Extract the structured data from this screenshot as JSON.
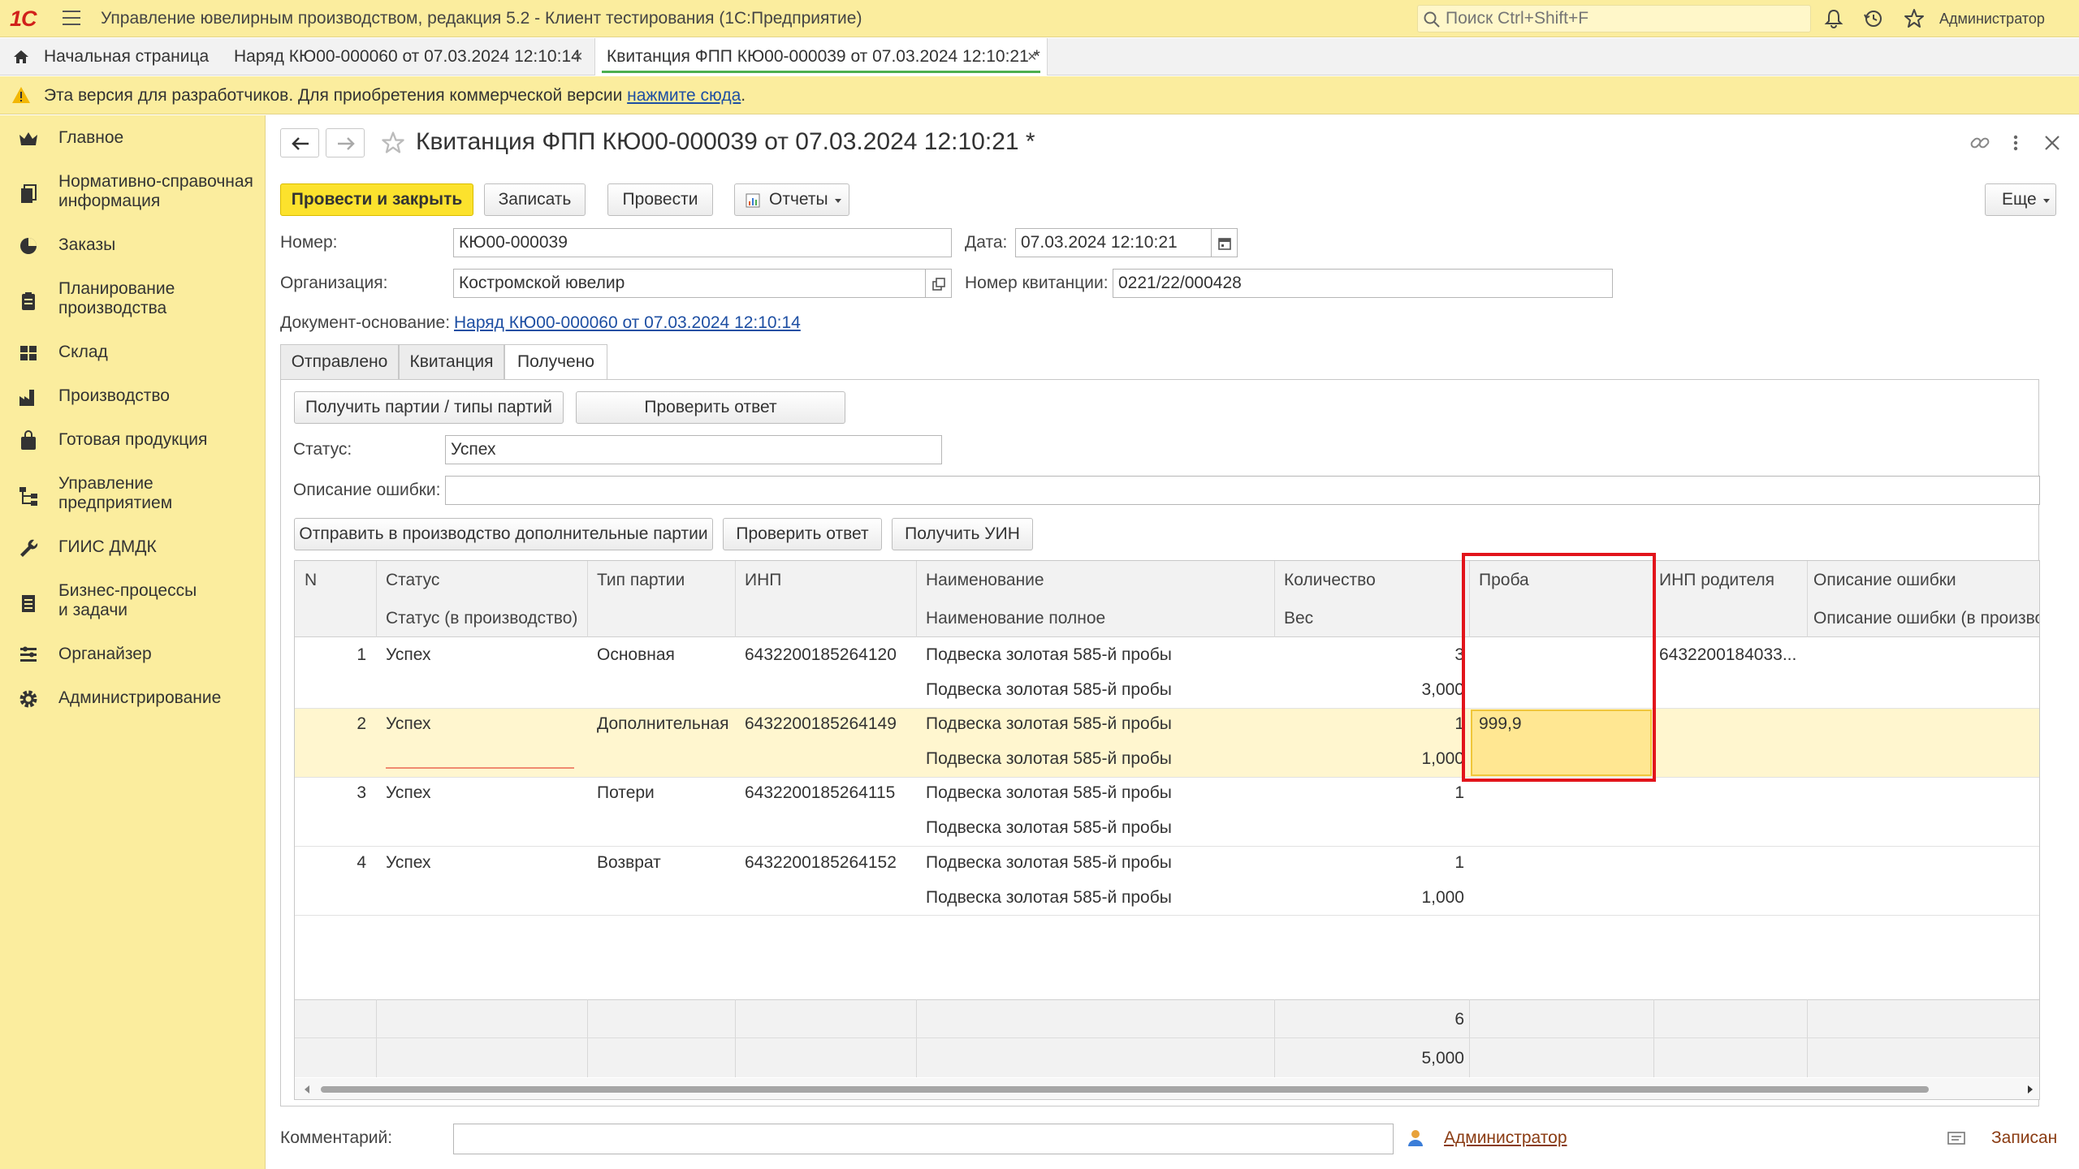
{
  "titlebar": {
    "logo": "1С",
    "app_title": "Управление ювелирным производством, редакция 5.2  - Клиент тестирования (1С:Предприятие)",
    "search_placeholder": "Поиск Ctrl+Shift+F",
    "user": "Администратор",
    "icons": [
      "menu-icon",
      "bell-icon",
      "history-icon",
      "star-icon"
    ]
  },
  "open_tabs": [
    {
      "label": "Начальная страница",
      "icon": "home-icon"
    },
    {
      "label": "Наряд КЮ00-000060 от 07.03.2024 12:10:14",
      "close": "×"
    },
    {
      "label": "Квитанция ФПП КЮ00-000039 от 07.03.2024 12:10:21 *",
      "close": "×",
      "active": true
    }
  ],
  "warning": {
    "text": "Эта версия для разработчиков. Для приобретения коммерческой версии ",
    "link": "нажмите сюда",
    "suffix": "."
  },
  "sidebar": {
    "items": [
      {
        "label": "Главное",
        "icon": "crown-icon"
      },
      {
        "label": "Нормативно-справочная\nинформация",
        "icon": "books-icon"
      },
      {
        "label": "Заказы",
        "icon": "pie-chart-icon"
      },
      {
        "label": "Планирование\nпроизводства",
        "icon": "clipboard-icon"
      },
      {
        "label": "Склад",
        "icon": "warehouse-icon"
      },
      {
        "label": "Производство",
        "icon": "factory-icon"
      },
      {
        "label": "Готовая продукция",
        "icon": "bag-icon"
      },
      {
        "label": "Управление\nпредприятием",
        "icon": "org-chart-icon"
      },
      {
        "label": "ГИИС ДМДК",
        "icon": "wrench-icon"
      },
      {
        "label": "Бизнес-процессы\nи задачи",
        "icon": "tasks-icon"
      },
      {
        "label": "Органайзер",
        "icon": "organizer-icon"
      },
      {
        "label": "Администрирование",
        "icon": "gear-icon"
      }
    ]
  },
  "form": {
    "title": "Квитанция ФПП КЮ00-000039 от 07.03.2024 12:10:21 *",
    "toolbar": {
      "post_close": "Провести и закрыть",
      "save": "Записать",
      "post": "Провести",
      "reports": "Отчеты",
      "more": "Еще"
    },
    "fields": {
      "number_label": "Номер:",
      "number_value": "КЮ00-000039",
      "date_label": "Дата:",
      "date_value": "07.03.2024 12:10:21",
      "org_label": "Организация:",
      "org_value": "Костромской ювелир",
      "receipt_label": "Номер квитанции:",
      "receipt_value": "0221/22/000428",
      "basis_label": "Документ-основание:",
      "basis_value": "Наряд КЮ00-000060 от 07.03.2024 12:10:14"
    },
    "tabs": [
      "Отправлено",
      "Квитанция",
      "Получено"
    ],
    "received": {
      "btn_get_lots": "Получить партии / типы партий",
      "btn_check_answer": "Проверить ответ",
      "status_label": "Статус:",
      "status_value": "Успех",
      "error_label": "Описание ошибки:",
      "error_value": "",
      "btn_send_extra": "Отправить в производство дополнительные партии",
      "btn_check_answer2": "Проверить ответ",
      "btn_get_uin": "Получить УИН"
    },
    "comment_label": "Комментарий:",
    "comment_value": "",
    "author": "Администратор",
    "saved_status": "Записан"
  },
  "table": {
    "headers_top": [
      "N",
      "Статус",
      "Тип партии",
      "ИНП",
      "Наименование",
      "Количество",
      "Проба",
      "ИНП родителя",
      "Описание ошибки"
    ],
    "headers_bottom": [
      "",
      "Статус (в производство)",
      "",
      "",
      "Наименование полное",
      "Вес",
      "",
      "",
      "Описание ошибки (в производство)"
    ],
    "rows": [
      {
        "n": "1",
        "status": "Успех",
        "type": "Основная",
        "inp": "6432200185264120",
        "name": "Подвеска золотая 585-й пробы",
        "name_full": "Подвеска золотая 585-й пробы",
        "qty": "3",
        "weight": "3,000",
        "proba": "",
        "parent": "6432200184033..."
      },
      {
        "n": "2",
        "status": "Успех",
        "type": "Дополнительная",
        "inp": "6432200185264149",
        "name": "Подвеска золотая 585-й пробы",
        "name_full": "Подвеска золотая 585-й пробы",
        "qty": "1",
        "weight": "1,000",
        "proba": "999,9",
        "parent": ""
      },
      {
        "n": "3",
        "status": "Успех",
        "type": "Потери",
        "inp": "6432200185264115",
        "name": "Подвеска золотая 585-й пробы",
        "name_full": "Подвеска золотая 585-й пробы",
        "qty": "1",
        "weight": "",
        "proba": "",
        "parent": ""
      },
      {
        "n": "4",
        "status": "Успех",
        "type": "Возврат",
        "inp": "6432200185264152",
        "name": "Подвеска золотая 585-й пробы",
        "name_full": "Подвеска золотая 585-й пробы",
        "qty": "1",
        "weight": "1,000",
        "proba": "",
        "parent": ""
      }
    ],
    "totals": {
      "qty": "6",
      "weight": "5,000"
    }
  },
  "colors": {
    "accent_yellow": "#fbed9e",
    "primary_button": "#fce22d",
    "highlight_red": "#e2141b",
    "selected_row": "#fff6cf",
    "active_tab_underline": "#4caf50"
  }
}
